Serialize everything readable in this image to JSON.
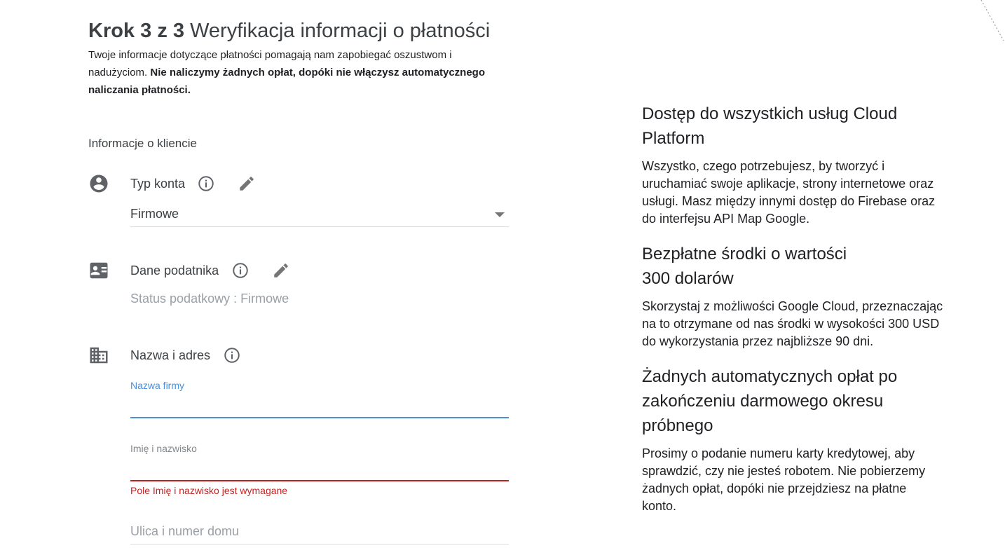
{
  "header": {
    "step": "Krok 3 z 3",
    "title": "Weryfikacja informacji o płatności",
    "intro_text": "Twoje informacje dotyczące płatności pomagają nam zapobiegać oszustwom i nadużyciom.",
    "intro_bold": "Nie naliczymy żadnych opłat, dopóki nie włączysz automatycznego naliczania płatności."
  },
  "customer_section": {
    "label": "Informacje o kliencie",
    "account_type": {
      "title": "Typ konta",
      "selected": "Firmowe"
    },
    "tax": {
      "title": "Dane podatnika",
      "status": "Status podatkowy : Firmowe"
    },
    "name_address": {
      "title": "Nazwa i adres",
      "company_label": "Nazwa firmy",
      "company_value": "",
      "fullname_label": "Imię i nazwisko",
      "fullname_value": "",
      "fullname_error": "Pole Imię i nazwisko jest wymagane",
      "street_placeholder": "Ulica i numer domu"
    }
  },
  "benefits": [
    {
      "title": "Dostęp do wszystkich usług Cloud Platform",
      "text": "Wszystko, czego potrzebujesz, by tworzyć i uruchamiać swoje aplikacje, strony internetowe oraz usługi. Masz między innymi dostęp do Firebase oraz do interfejsu API Map Google."
    },
    {
      "title": "Bezpłatne środki o wartości 300 dolarów",
      "text": "Skorzystaj z możliwości Google Cloud, przeznaczając na to otrzymane od nas środki w wysokości 300 USD do wykorzystania przez najbliższe 90 dni."
    },
    {
      "title": "Żadnych automatycznych opłat po zakończeniu darmowego okresu próbnego",
      "text": "Prosimy o podanie numeru karty kredytowej, aby sprawdzić, czy nie jesteś robotem. Nie pobierzemy żadnych opłat, dopóki nie przejdziesz na płatne konto."
    }
  ],
  "colors": {
    "focus_blue": "#4a90d9",
    "error_red": "#c5221f",
    "icon_gray": "#5f6368"
  },
  "icons": {
    "account": "account-circle-icon",
    "tax": "id-card-icon",
    "address": "business-building-icon",
    "info": "info-outline-icon",
    "edit": "pencil-icon",
    "dropdown": "arrow-drop-down-icon"
  }
}
